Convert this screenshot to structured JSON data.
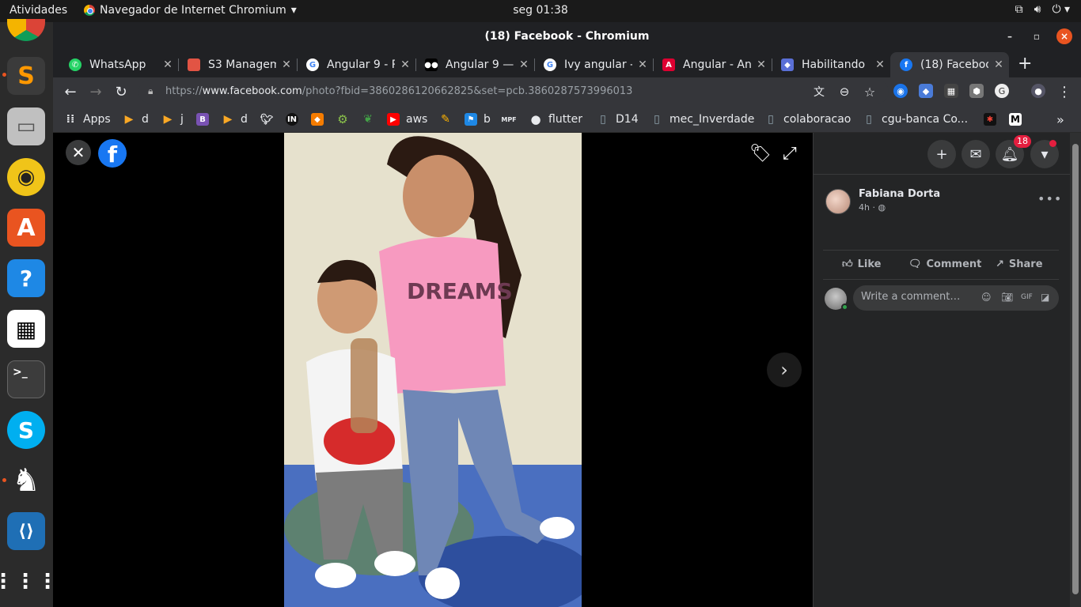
{
  "topbar": {
    "activities": "Atividades",
    "app_menu": "Navegador de Internet Chromium",
    "clock": "seg 01:38"
  },
  "window": {
    "title": "(18) Facebook - Chromium"
  },
  "tabs": [
    {
      "label": "WhatsApp",
      "icon": "whatsapp-icon",
      "color": "#25d366"
    },
    {
      "label": "S3 Managem",
      "icon": "aws-s3-icon",
      "color": "#e25444"
    },
    {
      "label": "Angular 9 - P",
      "icon": "google-icon",
      "color": "#4285f4"
    },
    {
      "label": "Angular 9 —",
      "icon": "medium-icon",
      "color": "#000000"
    },
    {
      "label": "Ivy angular -",
      "icon": "google-icon",
      "color": "#4285f4"
    },
    {
      "label": "Angular - An",
      "icon": "angular-icon",
      "color": "#dd0031"
    },
    {
      "label": "Habilitando",
      "icon": "cube-icon",
      "color": "#5a6fd6"
    },
    {
      "label": "(18) Faceboo",
      "icon": "facebook-icon",
      "color": "#1877f2"
    }
  ],
  "toolbar": {
    "url_prefix": "https://",
    "url_host": "www.facebook.com",
    "url_path": "/photo?fbid=3860286120662825&set=pcb.3860287573996013"
  },
  "bookmarks": [
    {
      "label": "Apps",
      "icon": "apps-grid-icon",
      "color": "#e8eaed"
    },
    {
      "label": "d",
      "icon": "play-icon",
      "color": "#f9a825"
    },
    {
      "label": "j",
      "icon": "play-icon",
      "color": "#f9a825"
    },
    {
      "label": "",
      "icon": "bootstrap-icon",
      "color": "#7952b3"
    },
    {
      "label": "d",
      "icon": "play-icon",
      "color": "#f9a825"
    },
    {
      "label": "",
      "icon": "bird-icon",
      "color": "#e8eaed"
    },
    {
      "label": "",
      "icon": "in-icon",
      "color": "#111111"
    },
    {
      "label": "",
      "icon": "box-icon",
      "color": "#f57c00"
    },
    {
      "label": "",
      "icon": "gear-icon",
      "color": "#8bc34a"
    },
    {
      "label": "",
      "icon": "leaf-icon",
      "color": "#43a047"
    },
    {
      "label": "aws",
      "icon": "youtube-icon",
      "color": "#ff0000"
    },
    {
      "label": "",
      "icon": "pen-icon",
      "color": "#ffb300"
    },
    {
      "label": "b",
      "icon": "flag-icon",
      "color": "#1e88e5"
    },
    {
      "label": "",
      "icon": "mpf-icon",
      "color": "#e8eaed"
    },
    {
      "label": "flutter",
      "icon": "github-icon",
      "color": "#e8eaed"
    },
    {
      "label": "D14",
      "icon": "page-icon",
      "color": "#90a4ae"
    },
    {
      "label": "mec_Inverdade",
      "icon": "page-icon",
      "color": "#90a4ae"
    },
    {
      "label": "colaboracao",
      "icon": "page-icon",
      "color": "#90a4ae"
    },
    {
      "label": "cgu-banca Co...",
      "icon": "page-icon",
      "color": "#90a4ae"
    }
  ],
  "post": {
    "author": "Fabiana Dorta",
    "time": "4h",
    "like": "Like",
    "comment": "Comment",
    "share": "Share",
    "comment_placeholder": "Write a comment…",
    "notifications": "18"
  },
  "colors": {
    "facebook_blue": "#1877f2",
    "notification_red": "#e41e3f",
    "ubuntu_orange": "#e95420"
  }
}
